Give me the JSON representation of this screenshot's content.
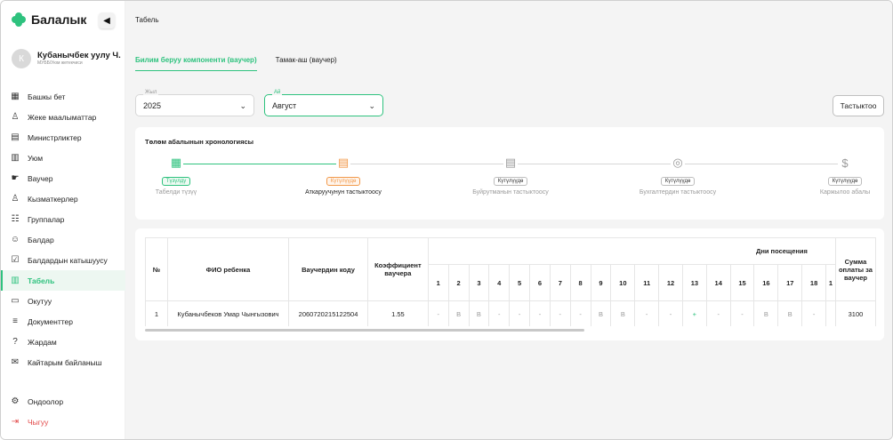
{
  "brand": {
    "name": "Балалык"
  },
  "user": {
    "initial": "К",
    "name": "Кубанычбек уулу Ч.",
    "role": "МУББ/Уюм жетекчиси"
  },
  "nav": [
    {
      "id": "home",
      "label": "Башкы бет",
      "icon": "grid-icon",
      "glyph": "▦"
    },
    {
      "id": "personal",
      "label": "Жеке маалыматтар",
      "icon": "user-icon",
      "glyph": "♙"
    },
    {
      "id": "ministries",
      "label": "Министрликтер",
      "icon": "document-list-icon",
      "glyph": "▤"
    },
    {
      "id": "org",
      "label": "Уюм",
      "icon": "building-icon",
      "glyph": "▥"
    },
    {
      "id": "voucher",
      "label": "Ваучер",
      "icon": "hand-coin-icon",
      "glyph": "☛"
    },
    {
      "id": "staff",
      "label": "Кызматкерлер",
      "icon": "staff-icon",
      "glyph": "♙"
    },
    {
      "id": "groups",
      "label": "Группалар",
      "icon": "group-icon",
      "glyph": "☷"
    },
    {
      "id": "children",
      "label": "Балдар",
      "icon": "child-icon",
      "glyph": "☺"
    },
    {
      "id": "attendance",
      "label": "Балдардын катышуусу",
      "icon": "checkbox-icon",
      "glyph": "☑"
    },
    {
      "id": "tabel",
      "label": "Табель",
      "icon": "journal-icon",
      "glyph": "▥",
      "active": true
    },
    {
      "id": "training",
      "label": "Окутуу",
      "icon": "training-icon",
      "glyph": "▭"
    },
    {
      "id": "docs",
      "label": "Документтер",
      "icon": "list-icon",
      "glyph": "≡"
    },
    {
      "id": "help",
      "label": "Жардам",
      "icon": "question-icon",
      "glyph": "?"
    },
    {
      "id": "feedback",
      "label": "Кайтарым байланыш",
      "icon": "chat-icon",
      "glyph": "✉"
    }
  ],
  "nav_bottom": [
    {
      "id": "settings",
      "label": "Ондоолор",
      "icon": "gear-icon",
      "glyph": "⚙"
    },
    {
      "id": "logout",
      "label": "Чыгуу",
      "icon": "logout-icon",
      "glyph": "⇥"
    }
  ],
  "breadcrumb": "Табель",
  "tabs": [
    {
      "label": "Билим беруу компоненти (ваучер)",
      "active": true
    },
    {
      "label": "Тамак-аш (ваучер)"
    }
  ],
  "filters": {
    "year": {
      "label": "Жыл",
      "value": "2025"
    },
    "month": {
      "label": "Ай",
      "value": "Август"
    },
    "confirm_label": "Тастыктоо"
  },
  "timeline": {
    "title": "Төлөм абалынын хронологиясы",
    "steps": [
      {
        "badge": "Түзүлдү",
        "label": "Табелди түзүү",
        "status": "done",
        "icon": "calendar-check-icon"
      },
      {
        "badge": "Күтүлүүдө",
        "label": "Аткаруучунун тастыктоосу",
        "status": "current",
        "icon": "document-clock-icon"
      },
      {
        "badge": "Күтүлүүдө",
        "label": "Буйрутманын тастыктоосу",
        "status": "pending",
        "icon": "document-check-icon"
      },
      {
        "badge": "Күтүлүүдө",
        "label": "Бухгалтердин тастыктоосу",
        "status": "pending",
        "icon": "check-circle-icon"
      },
      {
        "badge": "Күтүлүүдө",
        "label": "Каржылоо абалы",
        "status": "pending",
        "icon": "dollar-circle-icon"
      }
    ]
  },
  "table": {
    "headers": {
      "num": "№",
      "name": "ФИО ребенка",
      "code": "Ваучердин коду",
      "coef": "Коэффициент ваучера",
      "days_group": "Дни посещения",
      "sum": "Сумма оплаты за ваучер"
    },
    "days": [
      "1",
      "2",
      "3",
      "4",
      "5",
      "6",
      "7",
      "8",
      "9",
      "10",
      "11",
      "12",
      "13",
      "14",
      "15",
      "16",
      "17",
      "18",
      "1"
    ],
    "rows": [
      {
        "num": "1",
        "name": "Кубанычбеков Умар Чынгызович",
        "code": "2060720215122504",
        "coef": "1.55",
        "marks": [
          "-",
          "В",
          "В",
          "-",
          "-",
          "-",
          "-",
          "-",
          "В",
          "В",
          "-",
          "-",
          "+",
          "-",
          "-",
          "В",
          "В",
          "-",
          ""
        ],
        "sum": "3100"
      }
    ]
  }
}
